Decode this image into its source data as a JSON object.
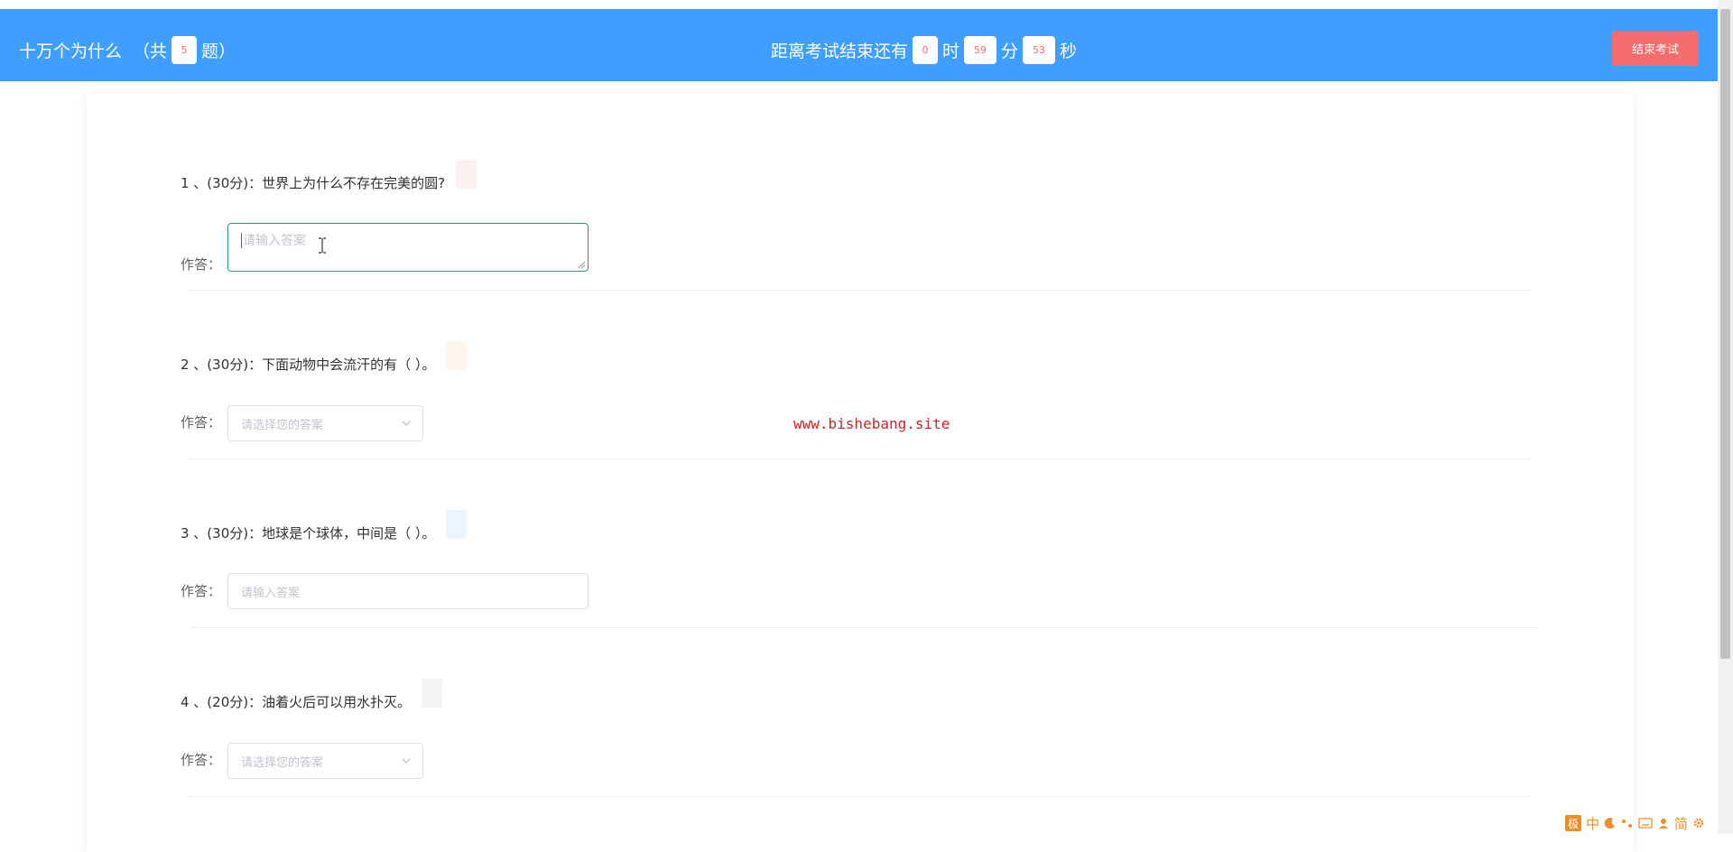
{
  "header": {
    "exam_title": "十万个为什么",
    "count_prefix": "（共",
    "question_count": "5",
    "count_suffix": "题）",
    "timer_prefix": "距离考试结束还有",
    "hours": "0",
    "hours_unit": "时",
    "minutes": "59",
    "minutes_unit": "分",
    "seconds": "53",
    "seconds_unit": "秒",
    "end_button": "结束考试"
  },
  "questions": [
    {
      "title": "1 、(30分)：世界上为什么不存在完美的圆?",
      "answer_label": "作答：",
      "placeholder": "请输入答案",
      "tag_color": "#fdf0f0"
    },
    {
      "title": "2 、(30分)：下面动物中会流汗的有（ ）。",
      "answer_label": "作答：",
      "placeholder": "请选择您的答案",
      "tag_color": "#fdf6ec"
    },
    {
      "title": "3 、(30分)：地球是个球体，中间是（ ）。",
      "answer_label": "作答：",
      "placeholder": "请输入答案",
      "tag_color": "#ecf5ff"
    },
    {
      "title": "4 、(20分)：油着火后可以用水扑灭。",
      "answer_label": "作答：",
      "placeholder": "请选择您的答案",
      "tag_color": "#f4f4f5"
    }
  ],
  "watermark": "www.bishebang.site",
  "ime": {
    "logo": "极",
    "mode": "中",
    "script": "简"
  },
  "colors": {
    "header_bg": "#409eff",
    "danger": "#f56c6c",
    "focus_border": "#2f9a6a",
    "watermark": "#d4202a",
    "ime": "#e8912c"
  }
}
